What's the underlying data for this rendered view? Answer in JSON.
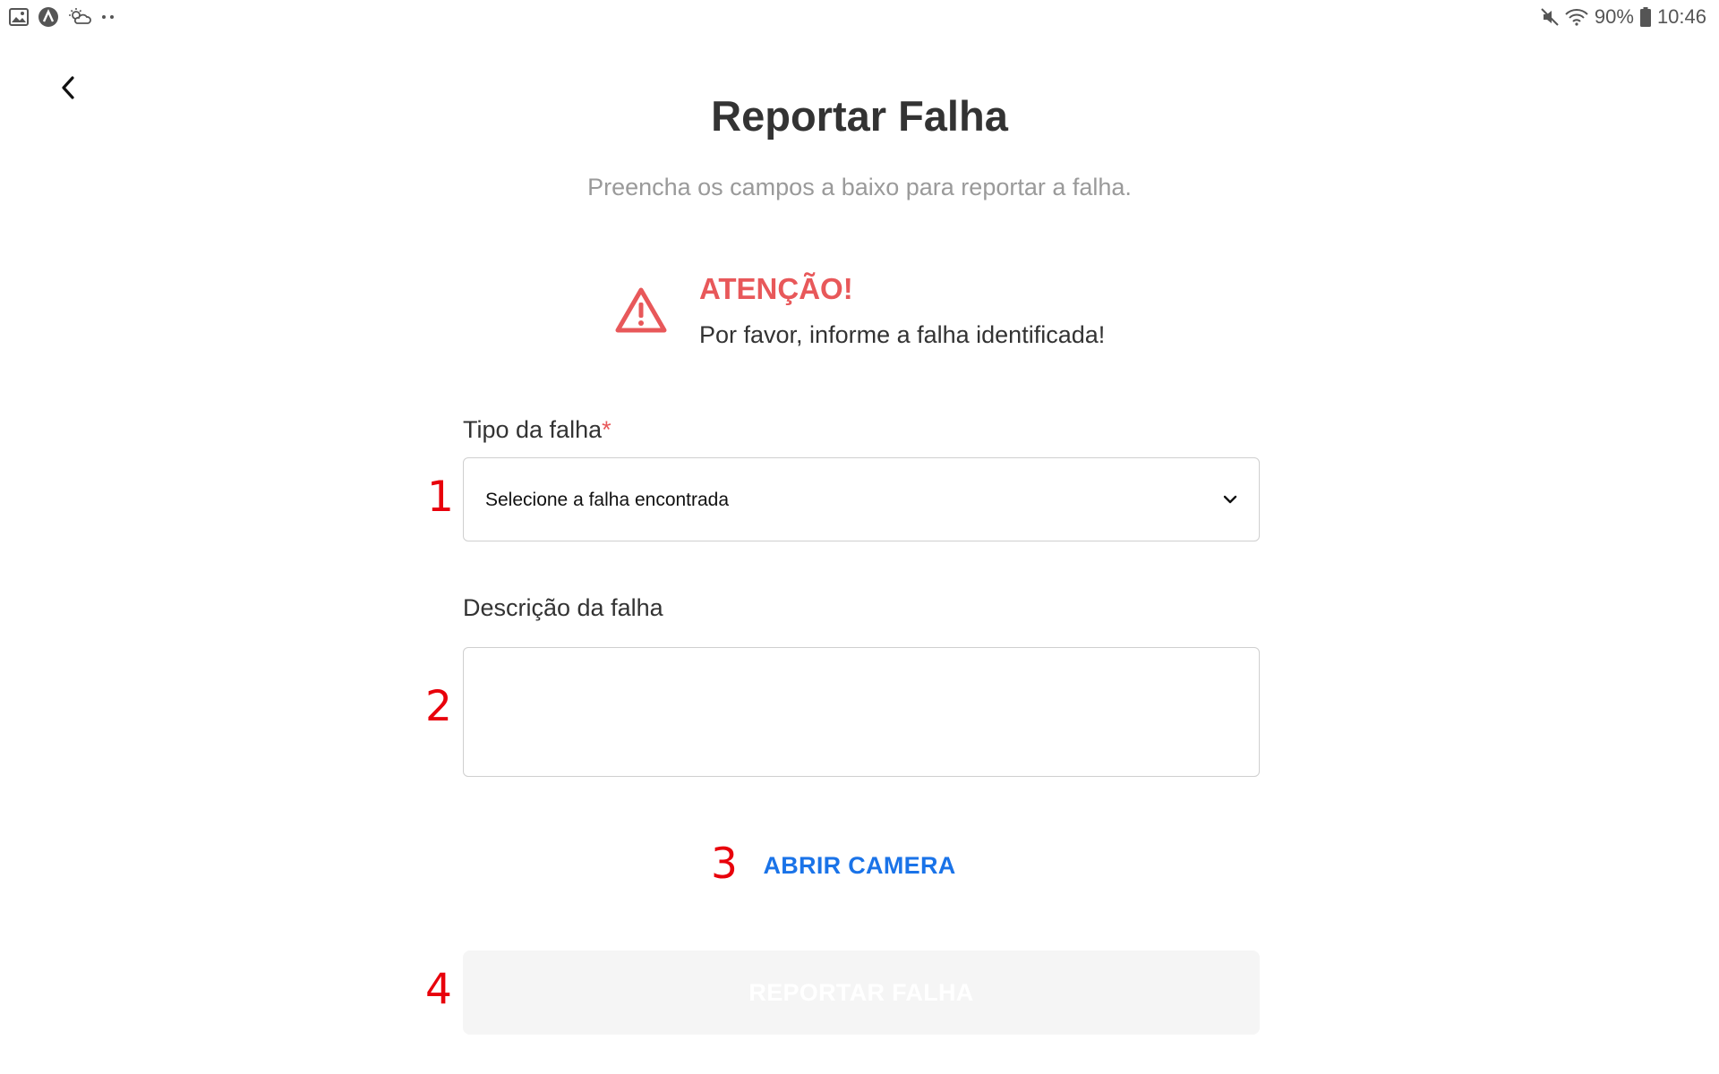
{
  "status_bar": {
    "icons_left": [
      "gallery-icon",
      "app-icon",
      "weather-icon",
      "more-dots-icon"
    ],
    "battery": "90%",
    "time": "10:46",
    "icons_right": [
      "mute-icon",
      "wifi-icon",
      "battery-icon"
    ]
  },
  "header": {
    "title": "Reportar Falha",
    "subtitle": "Preencha os campos a baixo para reportar a falha."
  },
  "warning": {
    "icon": "warning-triangle-icon",
    "title": "ATENÇÃO!",
    "text": "Por favor, informe a falha identificada!",
    "color": "#e8585a"
  },
  "form": {
    "fault_type": {
      "label": "Tipo da falha",
      "required_mark": "*",
      "selected": "Selecione a falha encontrada"
    },
    "description": {
      "label": "Descrição da falha",
      "value": ""
    },
    "open_camera_label": "ABRIR CAMERA",
    "submit_label": "REPORTAR FALHA"
  },
  "annotations": [
    "1",
    "2",
    "3",
    "4"
  ],
  "colors": {
    "accent": "#1a73e8",
    "alert": "#e8585a",
    "annotation": "#e8000b"
  }
}
